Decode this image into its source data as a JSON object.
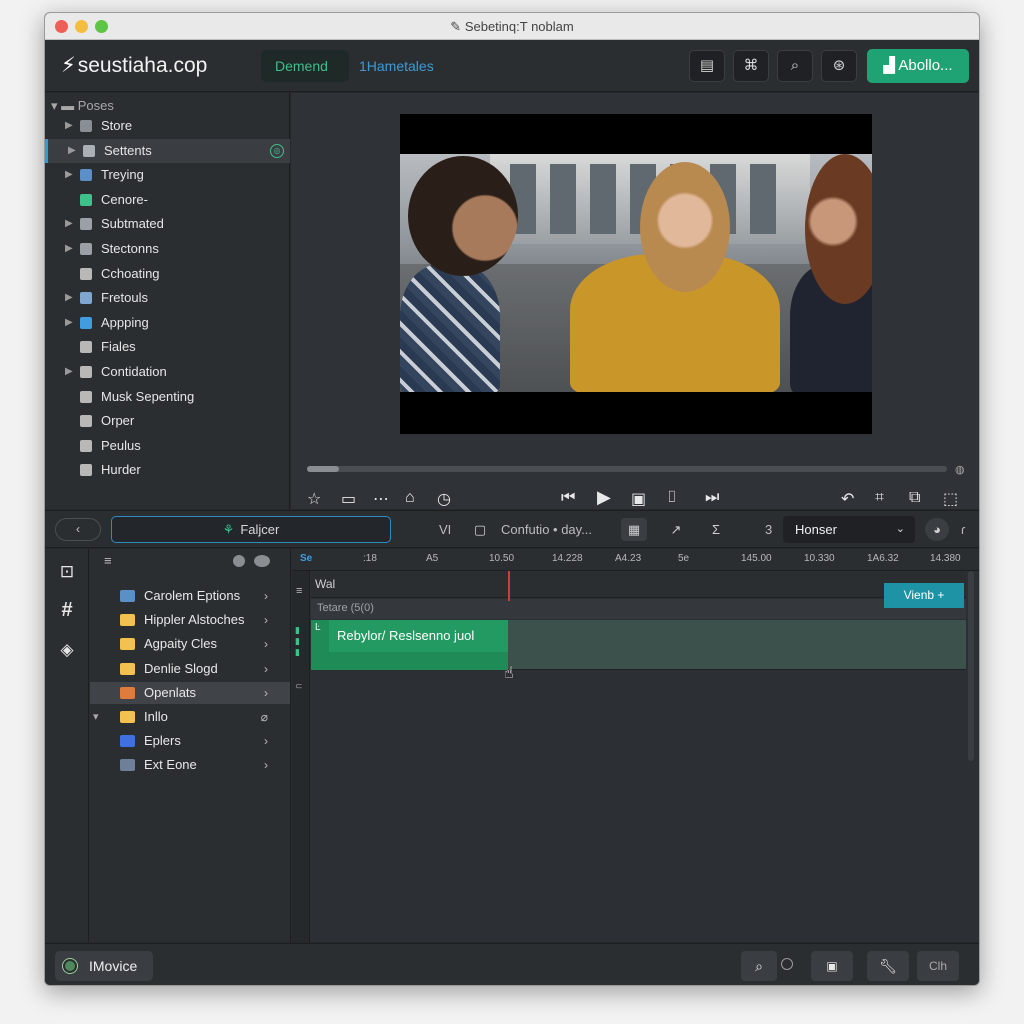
{
  "window": {
    "title": "Sebetinq:T noblam"
  },
  "appbar": {
    "brand": "seustiaha.cop",
    "segment_active": "Demend",
    "segment_inactive": "1Hametales",
    "cta_label": "Abollo..."
  },
  "sidebar": {
    "header": "Poses",
    "items": [
      {
        "label": "Store",
        "icon": "store-icon",
        "color": "#8a8f95"
      },
      {
        "label": "Settents",
        "icon": "settings-icon",
        "color": "#aab0b6"
      },
      {
        "label": "Treying",
        "icon": "window-icon",
        "color": "#5b8fc8"
      },
      {
        "label": "Cenore-",
        "icon": "circle-badge-icon",
        "color": "#3fbf8a"
      },
      {
        "label": "Subtmated",
        "icon": "list-icon",
        "color": "#9aa0a6"
      },
      {
        "label": "Stectonns",
        "icon": "image-icon",
        "color": "#9aa0a6"
      },
      {
        "label": "Cchoating",
        "icon": "wand-icon",
        "color": "#b8b8b8"
      },
      {
        "label": "Fretouls",
        "icon": "folder-icon",
        "color": "#7fa6cf"
      },
      {
        "label": "Appping",
        "icon": "app-icon",
        "color": "#3f9de0"
      },
      {
        "label": "Fiales",
        "icon": "tag-icon",
        "color": "#b8b8b8"
      },
      {
        "label": "Contidation",
        "icon": "gear-icon",
        "color": "#b8b8b8"
      },
      {
        "label": "Musk Sepenting",
        "icon": "music-icon",
        "color": "#b8b8b8"
      },
      {
        "label": "Orper",
        "icon": "user-icon",
        "color": "#b8b8b8"
      },
      {
        "label": "Peulus",
        "icon": "puzzle-icon",
        "color": "#b8b8b8"
      },
      {
        "label": "Hurder",
        "icon": "dial-icon",
        "color": "#b8b8b8"
      }
    ]
  },
  "viewer": {
    "scrub_progress": 0.05
  },
  "toolbar2": {
    "back_label": "‹",
    "search_value": "Faljcer",
    "label_vi": "VI",
    "label_context": "Confutio • day...",
    "label_num": "3",
    "select_value": "Honser"
  },
  "browser": {
    "items": [
      {
        "label": "Carolem Eptions",
        "color": "#5b8fc8"
      },
      {
        "label": "Hippler Alstoches",
        "color": "#f2c14e"
      },
      {
        "label": "Agpaity Cles",
        "color": "#f2c14e"
      },
      {
        "label": "Denlie Slogd",
        "color": "#f2c14e"
      },
      {
        "label": "Openlats",
        "color": "#e07b3c"
      },
      {
        "label": "Inllo",
        "color": "#f2c14e"
      },
      {
        "label": "Eplers",
        "color": "#3f6fe0"
      },
      {
        "label": "Ext Eone",
        "color": "#6e7f9a"
      }
    ]
  },
  "timeline": {
    "ruler_labels": [
      "Se",
      ":18",
      "A5",
      "10.50",
      "14.228",
      "A4.23",
      "5e",
      "145.00",
      "10.330",
      "1A6.32",
      "14.380"
    ],
    "track_label_1": "Wal",
    "track_label_2": "Tetare (5(0)",
    "clip_title": "Rebylor/ Reslsenno juol",
    "view_button": "Vienb +"
  },
  "statusbar": {
    "app_name": "IMovice",
    "btn_cli": "Clh"
  }
}
